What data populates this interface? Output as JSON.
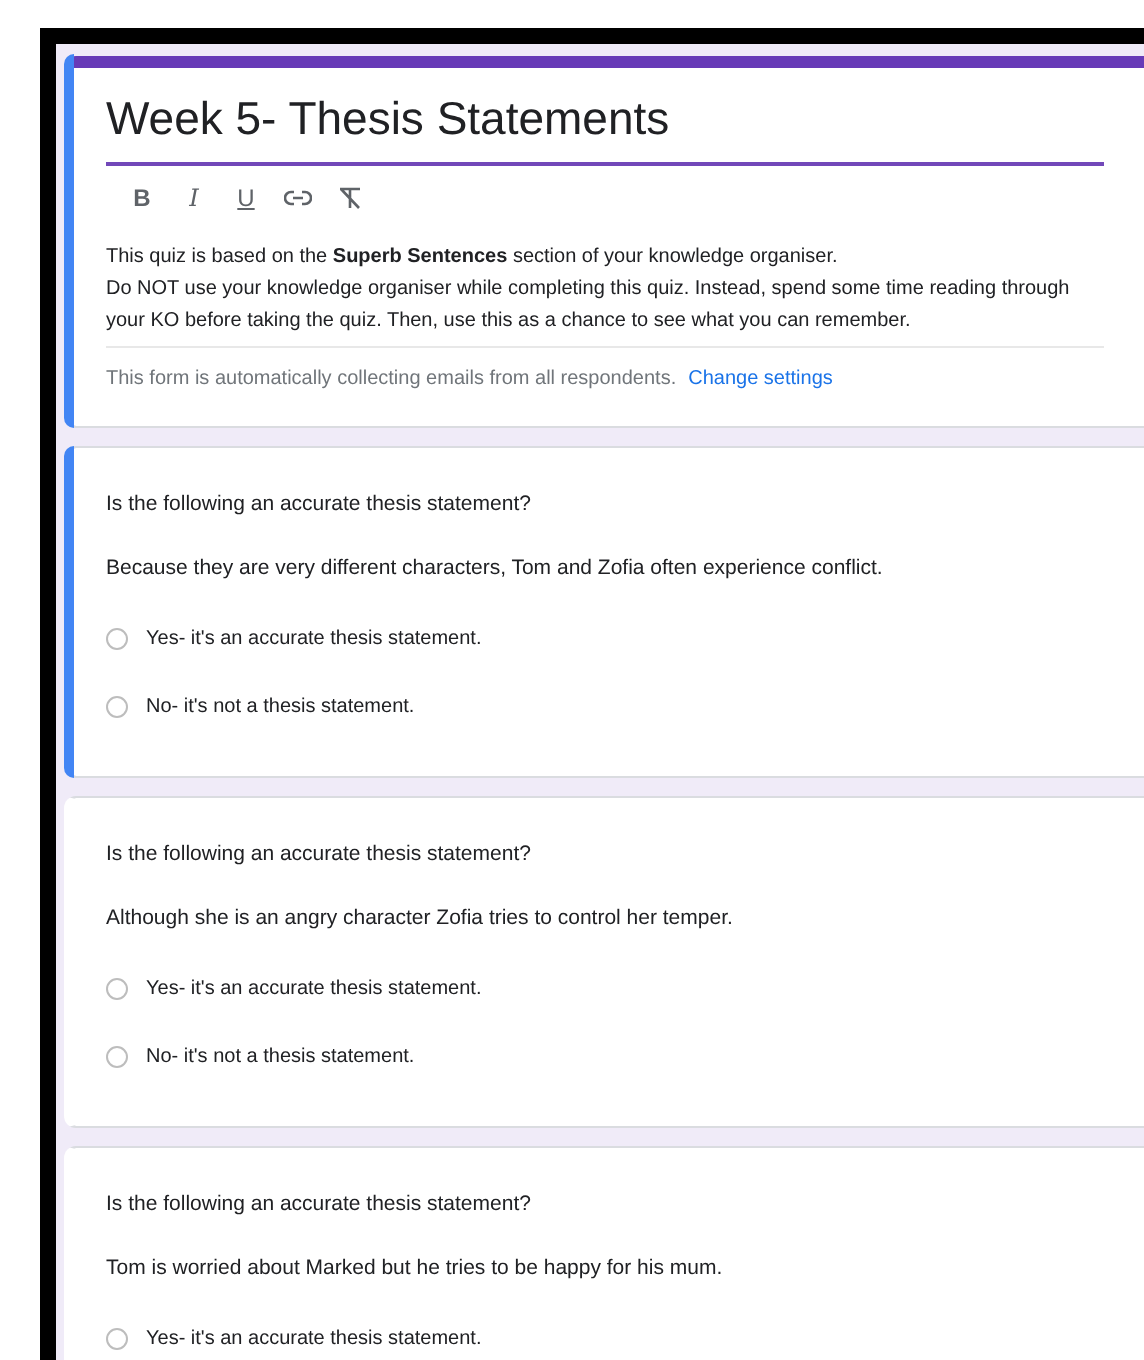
{
  "form": {
    "title": "Week 5- Thesis Statements",
    "focused": true,
    "toolbar": [
      {
        "kind": "bold",
        "label": "B"
      },
      {
        "kind": "italic",
        "label": "I"
      },
      {
        "kind": "underline",
        "label": "U"
      },
      {
        "kind": "link"
      },
      {
        "kind": "clear_format"
      }
    ],
    "description": [
      "This quiz is based on the **Superb Sentences** section of your knowledge organiser.",
      "Do NOT use your knowledge organiser while completing this quiz. Instead, spend some time reading through your KO before taking the quiz. Then, use this as a chance to see what you can remember."
    ],
    "email_notice": "This form is automatically collecting emails from all respondents.",
    "settings_link": "Change settings"
  },
  "questions": [
    {
      "title": "Is the following an accurate thesis statement?",
      "statement": "Because they are very different characters, Tom and Zofia often experience conflict.",
      "focused": true,
      "options": [
        {
          "label": "Yes- it's an accurate thesis statement.",
          "selected": false
        },
        {
          "label": "No- it's not a thesis statement.",
          "selected": false
        }
      ]
    },
    {
      "title": "Is the following an accurate thesis statement?",
      "statement": "Although she is an angry character Zofia tries to control her temper.",
      "focused": false,
      "options": [
        {
          "label": "Yes- it's an accurate thesis statement.",
          "selected": false
        },
        {
          "label": "No- it's not a thesis statement.",
          "selected": false
        }
      ]
    },
    {
      "title": "Is the following an accurate thesis statement?",
      "statement": "Tom is worried about Marked but he tries to be happy for his mum.",
      "focused": false,
      "options": [
        {
          "label": "Yes- it's an accurate thesis statement.",
          "selected": false
        }
      ]
    }
  ]
}
